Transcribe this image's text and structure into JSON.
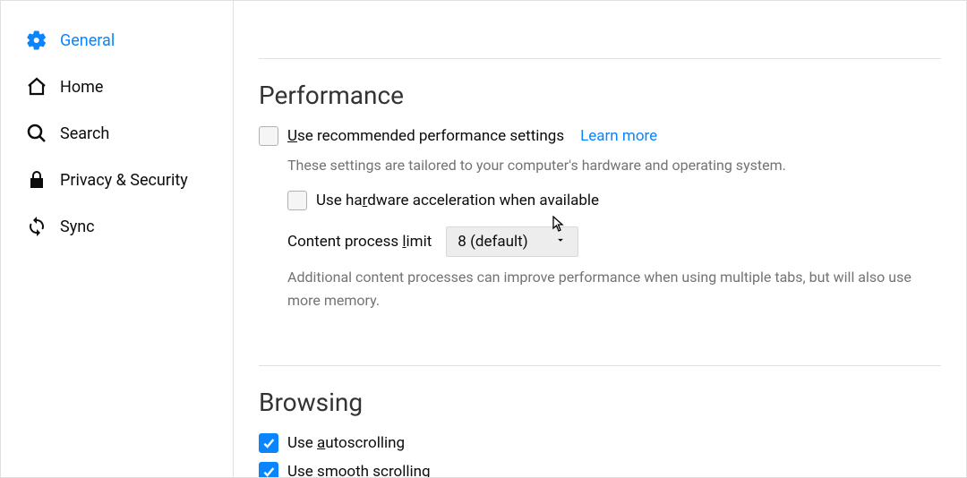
{
  "sidebar": {
    "items": [
      {
        "label": "General"
      },
      {
        "label": "Home"
      },
      {
        "label": "Search"
      },
      {
        "label": "Privacy & Security"
      },
      {
        "label": "Sync"
      }
    ]
  },
  "performance": {
    "heading": "Performance",
    "recommended": {
      "prefix": "U",
      "rest": "se recommended performance settings",
      "learnMore": "Learn more"
    },
    "desc1": "These settings are tailored to your computer's hardware and operating system.",
    "hw": {
      "prefix": "Use ha",
      "mid": "r",
      "rest": "dware acceleration when available"
    },
    "cpl": {
      "prefix": "Content process ",
      "mid": "l",
      "rest": "imit",
      "value": "8 (default)"
    },
    "desc2": "Additional content processes can improve performance when using multiple tabs, but will also use more memory."
  },
  "browsing": {
    "heading": "Browsing",
    "auto": {
      "prefix": "Use ",
      "mid": "a",
      "rest": "utoscrolling"
    },
    "smooth": {
      "prefix": "Use s",
      "mid": "m",
      "rest": "ooth scrolling"
    }
  }
}
